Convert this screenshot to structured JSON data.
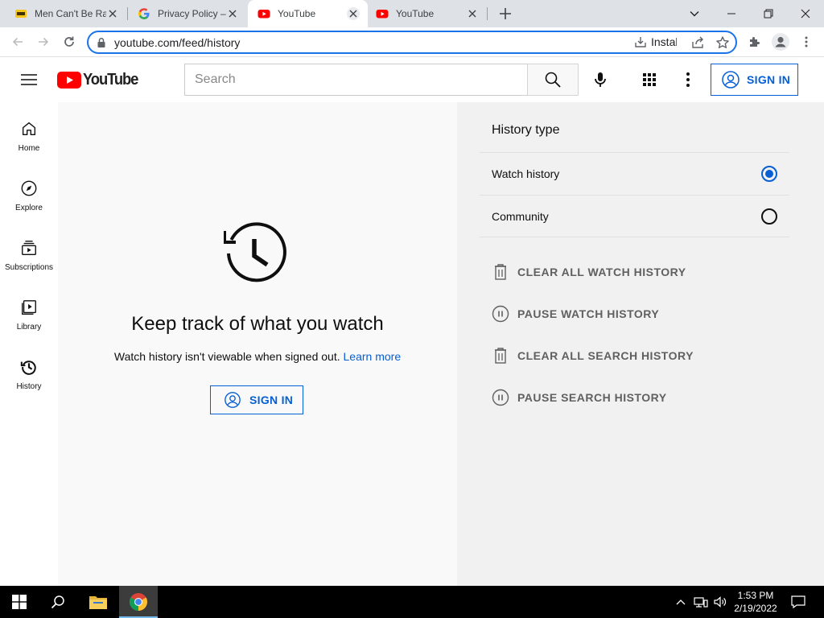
{
  "browser": {
    "tabs": [
      {
        "title": "Men Can't Be Ra",
        "favicon": "imdb-icon",
        "active": false
      },
      {
        "title": "Privacy Policy – ",
        "favicon": "google-icon",
        "active": false
      },
      {
        "title": "YouTube",
        "favicon": "youtube-icon",
        "active": true
      },
      {
        "title": "YouTube",
        "favicon": "youtube-icon",
        "active": false
      }
    ],
    "url": "youtube.com/feed/history",
    "install_label": "Install"
  },
  "masthead": {
    "logo_text": "YouTube",
    "search_placeholder": "Search",
    "signin_label": "SIGN IN"
  },
  "guide": {
    "items": [
      {
        "label": "Home",
        "icon": "home-icon"
      },
      {
        "label": "Explore",
        "icon": "compass-icon"
      },
      {
        "label": "Subscriptions",
        "icon": "subscriptions-icon"
      },
      {
        "label": "Library",
        "icon": "library-icon"
      },
      {
        "label": "History",
        "icon": "history-icon"
      }
    ]
  },
  "main": {
    "headline": "Keep track of what you watch",
    "subtext": "Watch history isn't viewable when signed out.",
    "learn_more": "Learn more",
    "signin_label": "SIGN IN"
  },
  "history_panel": {
    "title": "History type",
    "options": [
      {
        "label": "Watch history",
        "selected": true
      },
      {
        "label": "Community",
        "selected": false
      }
    ],
    "actions": [
      {
        "label": "CLEAR ALL WATCH HISTORY",
        "icon": "trash-icon"
      },
      {
        "label": "PAUSE WATCH HISTORY",
        "icon": "pause-circle-icon"
      },
      {
        "label": "CLEAR ALL SEARCH HISTORY",
        "icon": "trash-icon"
      },
      {
        "label": "PAUSE SEARCH HISTORY",
        "icon": "pause-circle-icon"
      }
    ]
  },
  "taskbar": {
    "time": "1:53 PM",
    "date": "2/19/2022"
  },
  "colors": {
    "accent_blue": "#065fd4",
    "youtube_red": "#ff0000",
    "chrome_focus": "#1a73e8"
  }
}
